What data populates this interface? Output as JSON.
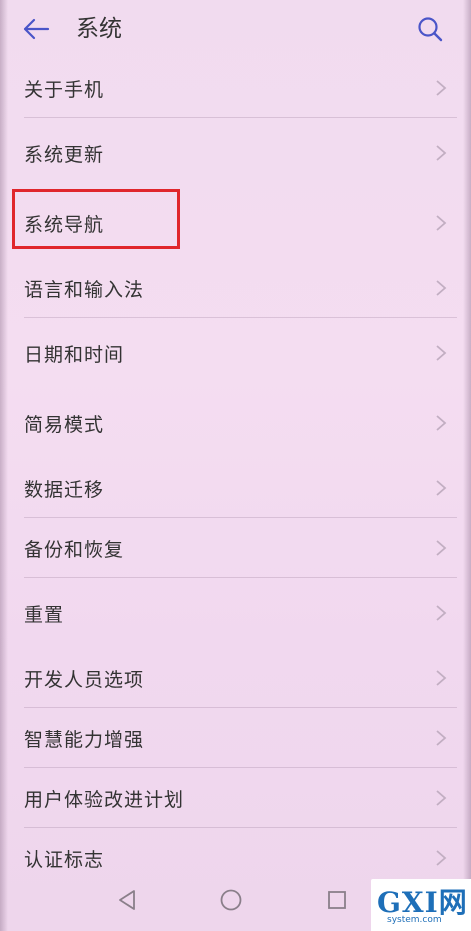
{
  "header": {
    "title": "系统",
    "back_icon": "arrow-left-icon",
    "search_icon": "search-icon",
    "accent_color": "#4a55c8"
  },
  "menu": {
    "items": [
      {
        "label": "关于手机"
      },
      {
        "label": "系统更新"
      },
      {
        "label": "系统导航"
      },
      {
        "label": "语言和输入法"
      },
      {
        "label": "日期和时间"
      },
      {
        "label": "简易模式"
      },
      {
        "label": "数据迁移"
      },
      {
        "label": "备份和恢复"
      },
      {
        "label": "重置"
      },
      {
        "label": "开发人员选项"
      },
      {
        "label": "智慧能力增强"
      },
      {
        "label": "用户体验改进计划"
      },
      {
        "label": "认证标志"
      }
    ],
    "highlighted_item": "系统导航",
    "highlight_color": "#e0262c"
  },
  "navbar": {
    "back_icon": "triangle-back-icon",
    "home_icon": "circle-home-icon",
    "recent_icon": "square-recent-icon"
  },
  "watermark": {
    "main": "GXI网",
    "sub": "system.com"
  }
}
